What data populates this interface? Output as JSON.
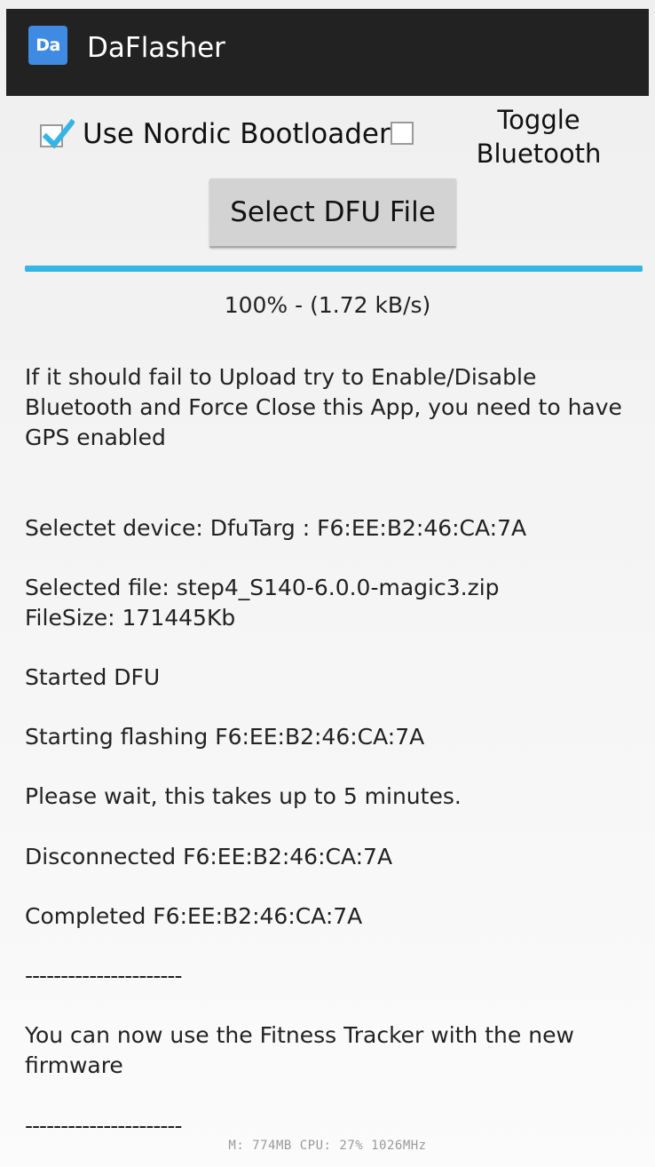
{
  "app": {
    "icon_text": "Da",
    "title": "DaFlasher"
  },
  "controls": {
    "nordic_bootloader": {
      "label": "Use Nordic Bootloader",
      "checked": true
    },
    "toggle_bluetooth": {
      "label": "Toggle\nBluetooth",
      "checked": false
    },
    "select_button_label": "Select DFU File"
  },
  "progress": {
    "percent": 100,
    "text": "100% - (1.72 kB/s)"
  },
  "log": [
    "If it should fail to Upload try to Enable/Disable Bluetooth and Force Close this App, you need to have GPS enabled",
    "Selectet device: DfuTarg : F6:EE:B2:46:CA:7A",
    "Selected file: step4_S140-6.0.0-magic3.zip\nFileSize: 171445Kb",
    "Started DFU",
    "Starting flashing F6:EE:B2:46:CA:7A",
    "Please wait, this takes up to 5 minutes.",
    "Disconnected F6:EE:B2:46:CA:7A",
    "Completed F6:EE:B2:46:CA:7A",
    "----------------------",
    "You can now use the Fitness Tracker with the new firmware",
    "----------------------"
  ],
  "system_overlay": "M: 774MB CPU: 27% 1026MHz",
  "colors": {
    "action_bar": "#222222",
    "app_icon": "#3f8be3",
    "checkbox_accent": "#33b5e5",
    "progress": "#33b5e5"
  }
}
